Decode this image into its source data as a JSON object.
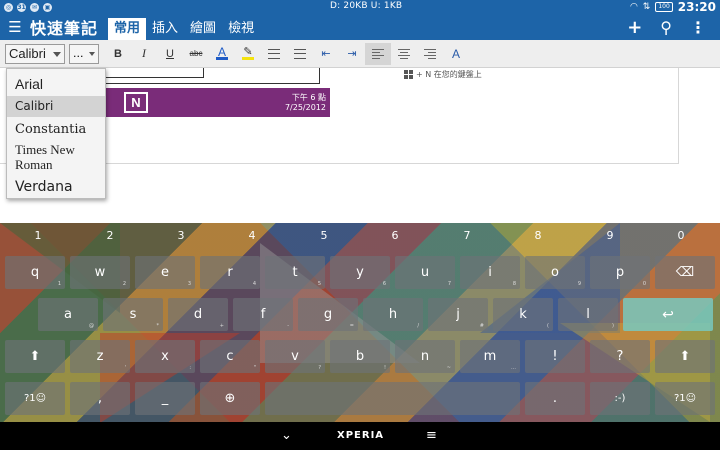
{
  "status_bar": {
    "center_text": "D: 20KB  U: 1KB",
    "time": "23:20",
    "battery": "100"
  },
  "app_bar": {
    "title": "快速筆記",
    "tabs": [
      {
        "label": "常用",
        "active": true
      },
      {
        "label": "插入",
        "active": false
      },
      {
        "label": "繪圖",
        "active": false
      },
      {
        "label": "檢視",
        "active": false
      }
    ]
  },
  "toolbar": {
    "font_value": "Calibri",
    "size_value": "...",
    "bold": "B",
    "italic": "I",
    "underline": "U",
    "strikethrough": "abc",
    "font_color_label": "A",
    "font_color": "#1e5bc6",
    "highlight_color": "#f4e30e"
  },
  "font_dropdown": {
    "options": [
      "Arial",
      "Calibri",
      "Constantia",
      "Times New Roman",
      "Verdana"
    ],
    "selected": "Calibri"
  },
  "canvas": {
    "note_date_line1": "下午 6 點",
    "note_date_line2": "7/25/2012",
    "note_app_letter": "N",
    "hint_text": "+ N  在您的鍵盤上"
  },
  "keyboard": {
    "numbers": [
      "1",
      "2",
      "3",
      "4",
      "5",
      "6",
      "7",
      "8",
      "9",
      "0"
    ],
    "row1": [
      {
        "k": "q",
        "sub": "1"
      },
      {
        "k": "w",
        "sub": "2"
      },
      {
        "k": "e",
        "sub": "3"
      },
      {
        "k": "r",
        "sub": "4"
      },
      {
        "k": "t",
        "sub": "5"
      },
      {
        "k": "y",
        "sub": "6"
      },
      {
        "k": "u",
        "sub": "7"
      },
      {
        "k": "i",
        "sub": "8"
      },
      {
        "k": "o",
        "sub": "9"
      },
      {
        "k": "p",
        "sub": "0"
      }
    ],
    "row2": [
      {
        "k": "a",
        "sub": "@"
      },
      {
        "k": "s",
        "sub": "*"
      },
      {
        "k": "d",
        "sub": "+"
      },
      {
        "k": "f",
        "sub": "-"
      },
      {
        "k": "g",
        "sub": "="
      },
      {
        "k": "h",
        "sub": "/"
      },
      {
        "k": "j",
        "sub": "#"
      },
      {
        "k": "k",
        "sub": "("
      },
      {
        "k": "l",
        "sub": ")"
      }
    ],
    "row3": [
      {
        "k": "z",
        "sub": "'"
      },
      {
        "k": "x",
        "sub": ":"
      },
      {
        "k": "c",
        "sub": "\""
      },
      {
        "k": "v",
        "sub": "?"
      },
      {
        "k": "b",
        "sub": "!"
      },
      {
        "k": "n",
        "sub": "~"
      },
      {
        "k": "m",
        "sub": "…"
      },
      {
        "k": "!",
        "sub": ""
      },
      {
        "k": "?",
        "sub": ""
      }
    ],
    "symbols_label": "?1☺",
    "comma_label": ",",
    "underscore_label": "_",
    "globe_label": "⊕",
    "period_label": ".",
    "smiley_label": ":-)",
    "backspace_label": "⌫",
    "enter_label": "↩",
    "shift_label": "⬆",
    "symbols_right_label": "?1☺"
  },
  "nav_bar": {
    "back_label": "⌄",
    "brand": "XPERIA",
    "menu_label": "≡"
  }
}
